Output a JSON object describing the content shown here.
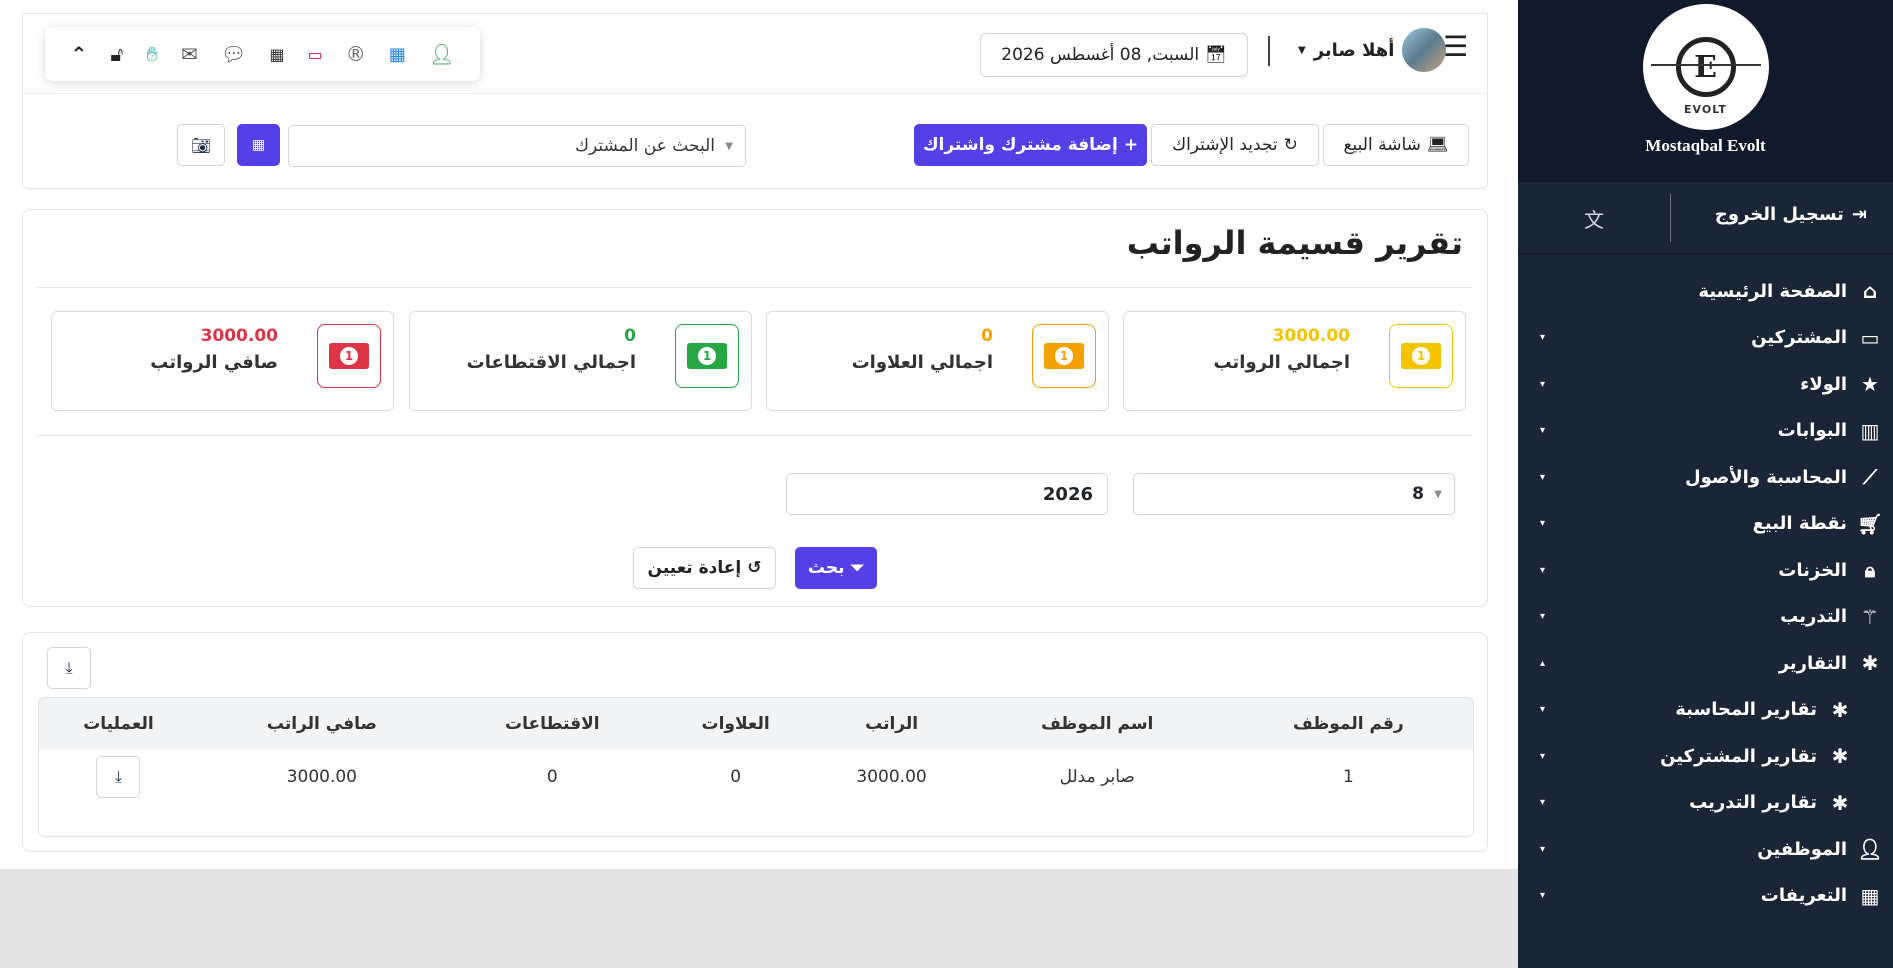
{
  "brand": {
    "name": "Mostaqbal Evolt",
    "logo_text": "EVOLT"
  },
  "sidebar": {
    "logout_label": "تسجيل الخروج",
    "items": [
      {
        "label": "الصفحة الرئيسية",
        "icon": "home-icon",
        "caret": ""
      },
      {
        "label": "المشتركين",
        "icon": "laptop-icon",
        "caret": "▾"
      },
      {
        "label": "الولاء",
        "icon": "star-icon",
        "caret": "▾"
      },
      {
        "label": "البوابات",
        "icon": "building-icon",
        "caret": "▾"
      },
      {
        "label": "المحاسبة والأصول",
        "icon": "chart-line-icon",
        "caret": "▾"
      },
      {
        "label": "نقطة البيع",
        "icon": "cart-icon",
        "caret": "▾"
      },
      {
        "label": "الخزنات",
        "icon": "lock-icon",
        "caret": "▾"
      },
      {
        "label": "التدريب",
        "icon": "magic-icon",
        "caret": "▾"
      },
      {
        "label": "التقارير",
        "icon": "bug-icon",
        "caret": "▴"
      },
      {
        "label": "تقارير المحاسبة",
        "icon": "bug-icon",
        "caret": "▾"
      },
      {
        "label": "تقارير المشتركين",
        "icon": "bug-icon",
        "caret": "▾"
      },
      {
        "label": "تقارير التدريب",
        "icon": "bug-icon",
        "caret": "▾"
      },
      {
        "label": "الموظفين",
        "icon": "user-icon",
        "caret": "▾"
      },
      {
        "label": "التعريفات",
        "icon": "table-icon",
        "caret": "▾"
      }
    ]
  },
  "header": {
    "user_greeting": "أهلا صابر",
    "date": "السبت, 08 أغسطس 2026"
  },
  "actions": {
    "pos_screen": "شاشة البيع",
    "renew": "تجديد الإشتراك",
    "add_subscriber": "إضافة مشترك واشتراك",
    "search_placeholder": "البحث عن المشترك"
  },
  "report": {
    "title": "تقرير قسيمة الرواتب",
    "stats": [
      {
        "label": "اجمالي الرواتب",
        "value": "3000.00",
        "color": "#f5c400"
      },
      {
        "label": "اجمالي العلاوات",
        "value": "0",
        "color": "#f5a100"
      },
      {
        "label": "اجمالي الاقتطاعات",
        "value": "0",
        "color": "#28a745"
      },
      {
        "label": "صافي الرواتب",
        "value": "3000.00",
        "color": "#dc3545"
      }
    ],
    "filter_month": "8",
    "filter_year": "2026",
    "search_btn": "بحث",
    "reset_btn": "إعادة تعيين"
  },
  "table": {
    "columns": [
      "رقم الموظف",
      "اسم الموظف",
      "الراتب",
      "العلاوات",
      "الاقتطاعات",
      "صافي الراتب",
      "العمليات"
    ],
    "rows": [
      {
        "id": "1",
        "name": "صابر مدلل",
        "salary": "3000.00",
        "allowances": "0",
        "deductions": "0",
        "net": "3000.00"
      }
    ]
  },
  "colors": {
    "primary": "#5340e6",
    "sidebar": "#1a2536",
    "sidebar_header": "#101a2a"
  }
}
